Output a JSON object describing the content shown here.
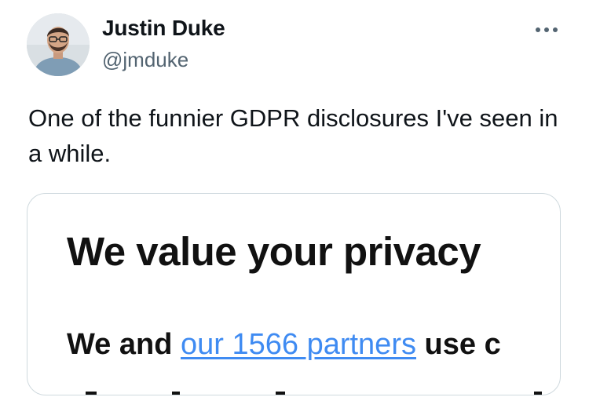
{
  "tweet": {
    "author": {
      "display_name": "Justin Duke",
      "handle": "@jmduke",
      "avatar_icon": "profile-photo"
    },
    "more_icon": "more-horizontal-icon",
    "text": "One of the funnier GDPR disclosures I've seen in a while.",
    "media": {
      "heading": "We value your privacy",
      "body_prefix": "We and",
      "body_link": "our 1566 partners",
      "body_suffix": "use c",
      "link_color": "#3f8bf2"
    }
  },
  "colors": {
    "text_primary": "#0f1419",
    "text_secondary": "#536471",
    "card_border": "#cfd9de"
  }
}
